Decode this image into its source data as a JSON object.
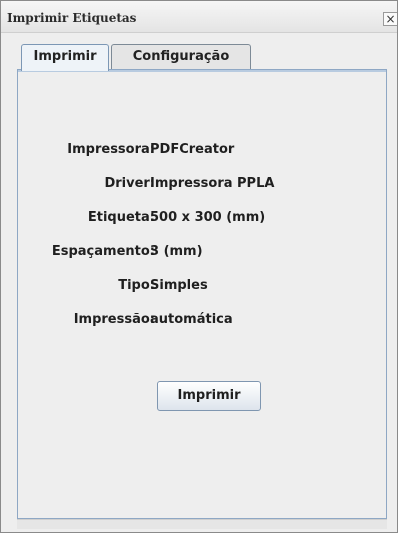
{
  "window": {
    "title": "Imprimir Etiquetas",
    "close_glyph": "×"
  },
  "tabs": [
    {
      "label": "Imprimir",
      "active": true
    },
    {
      "label": "Configuração",
      "active": false
    }
  ],
  "details": [
    {
      "label": "Impressora:",
      "value": "PDFCreator"
    },
    {
      "label": "Driver:",
      "value": "Impressora PPLA"
    },
    {
      "label": "Etiqueta:",
      "value": "500 x 300 (mm)"
    },
    {
      "label": "Espaçamento:",
      "value": "3 (mm)"
    },
    {
      "label": "Tipo:",
      "value": "Simples"
    },
    {
      "label": "Impressão:",
      "value": "automática"
    }
  ],
  "actions": {
    "print_label": "Imprimir"
  },
  "colors": {
    "tab_border_active": "#7c97b5",
    "panel_border": "#8ea7c4"
  }
}
